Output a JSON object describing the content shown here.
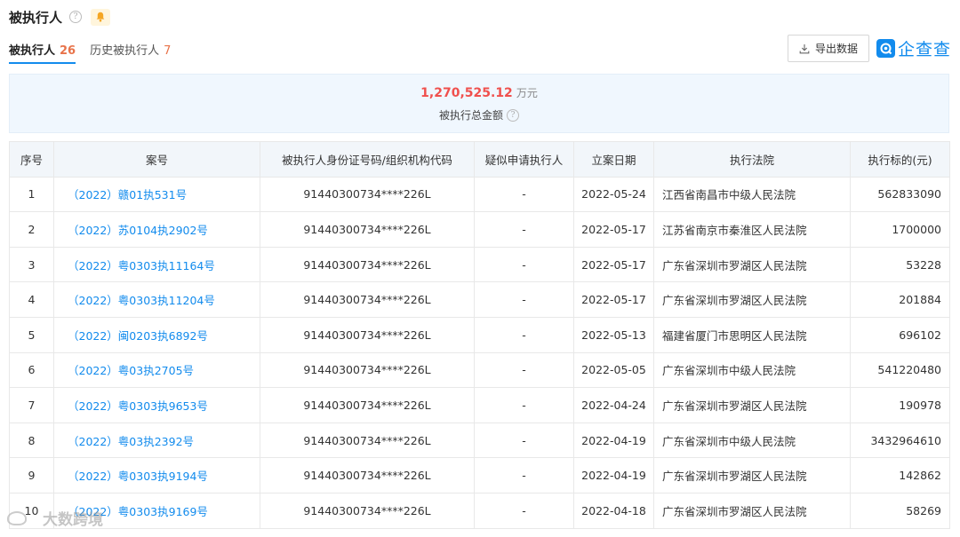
{
  "header": {
    "title": "被执行人",
    "info_icon": "?"
  },
  "tabs": [
    {
      "label": "被执行人",
      "count": "26",
      "active": true
    },
    {
      "label": "历史被执行人",
      "count": "7",
      "active": false
    }
  ],
  "toolbar": {
    "export_label": "导出数据",
    "logo_text": "企查查"
  },
  "summary": {
    "amount": "1,270,525.12",
    "unit": "万元",
    "label": "被执行总金额"
  },
  "table": {
    "headers": [
      "序号",
      "案号",
      "被执行人身份证号码/组织机构代码",
      "疑似申请执行人",
      "立案日期",
      "执行法院",
      "执行标的(元)"
    ],
    "rows": [
      [
        "1",
        "（2022）赣01执531号",
        "91440300734****226L",
        "-",
        "2022-05-24",
        "江西省南昌市中级人民法院",
        "562833090"
      ],
      [
        "2",
        "（2022）苏0104执2902号",
        "91440300734****226L",
        "-",
        "2022-05-17",
        "江苏省南京市秦淮区人民法院",
        "1700000"
      ],
      [
        "3",
        "（2022）粤0303执11164号",
        "91440300734****226L",
        "-",
        "2022-05-17",
        "广东省深圳市罗湖区人民法院",
        "53228"
      ],
      [
        "4",
        "（2022）粤0303执11204号",
        "91440300734****226L",
        "-",
        "2022-05-17",
        "广东省深圳市罗湖区人民法院",
        "201884"
      ],
      [
        "5",
        "（2022）闽0203执6892号",
        "91440300734****226L",
        "-",
        "2022-05-13",
        "福建省厦门市思明区人民法院",
        "696102"
      ],
      [
        "6",
        "（2022）粤03执2705号",
        "91440300734****226L",
        "-",
        "2022-05-05",
        "广东省深圳市中级人民法院",
        "541220480"
      ],
      [
        "7",
        "（2022）粤0303执9653号",
        "91440300734****226L",
        "-",
        "2022-04-24",
        "广东省深圳市罗湖区人民法院",
        "190978"
      ],
      [
        "8",
        "（2022）粤03执2392号",
        "91440300734****226L",
        "-",
        "2022-04-19",
        "广东省深圳市中级人民法院",
        "3432964610"
      ],
      [
        "9",
        "（2022）粤0303执9194号",
        "91440300734****226L",
        "-",
        "2022-04-19",
        "广东省深圳市罗湖区人民法院",
        "142862"
      ],
      [
        "10",
        "（2022）粤0303执9169号",
        "91440300734****226L",
        "-",
        "2022-04-18",
        "广东省深圳市罗湖区人民法院",
        "58269"
      ]
    ]
  },
  "watermark": {
    "text": "大数跨境"
  },
  "colors": {
    "accent": "#128bed",
    "count": "#e8734a",
    "amount": "#f0504d"
  }
}
